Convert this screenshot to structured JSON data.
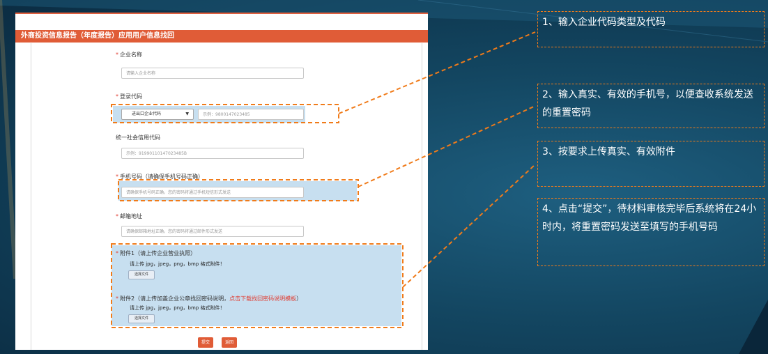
{
  "form": {
    "title": "外商投资信息报告（年度报告）应用用户信息找回",
    "company_name": {
      "label": "企业名称",
      "placeholder": "请输入企业名称"
    },
    "login_code": {
      "label": "登录代码",
      "select_value": "进出口企业代码",
      "placeholder": "示例：9800147023485"
    },
    "credit_code": {
      "label": "统一社会信用代码",
      "placeholder": "示例：91990110147023485B"
    },
    "phone": {
      "label": "手机号码（请确保手机号码正确）",
      "placeholder": "请确保手机号码正确，您的密码将通过手机短信形式发送"
    },
    "email": {
      "label": "邮箱地址",
      "placeholder": "请确保邮箱地址正确，您的密码将通过邮件形式发送"
    },
    "attachment1": {
      "label": "附件1（请上传企业营业执照）",
      "note": "请上传 jpg，jpeg，png，bmp 格式附件！",
      "button": "选择文件"
    },
    "attachment2": {
      "label_prefix": "附件2（请上传加盖企业公章找回密码说明，",
      "label_link": "点击下载找回密码说明模板",
      "label_suffix": "）",
      "note": "请上传 jpg，jpeg，png，bmp 格式附件！",
      "button": "选择文件"
    },
    "submit_label": "提交",
    "back_label": "返回",
    "required_mark": "*"
  },
  "callouts": [
    "1、输入企业代码类型及代码",
    "2、输入真实、有效的手机号，以便查收系统发送的重置密码",
    "3、按要求上传真实、有效附件",
    "4、点击“提交”，待材料审核完毕后系统将在24小时内，将重置密码发送至填写的手机号码"
  ],
  "colors": {
    "accent": "#e05c37",
    "highlight": "#c7dff0",
    "callout_border": "#f07b1a",
    "background": "#134661"
  }
}
